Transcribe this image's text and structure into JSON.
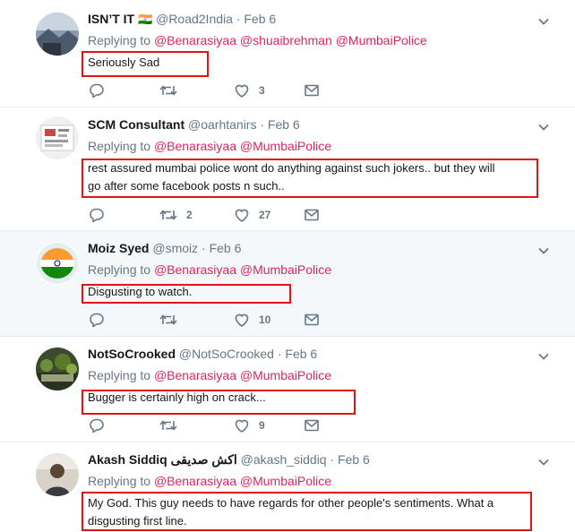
{
  "tweets": [
    {
      "name": "ISN’T IT",
      "flag": "🇮🇳",
      "handle": "@Road2India",
      "date": "Feb 6",
      "replying_to": "Replying to",
      "mentions": [
        "@Benarasiyaa",
        "@shuaibrehman",
        "@MumbaiPolice"
      ],
      "text": "Seriously Sad",
      "replies": "",
      "retweets": "",
      "likes": "3"
    },
    {
      "name": "SCM Consultant",
      "handle": "@oarhtanirs",
      "date": "Feb 6",
      "replying_to": "Replying to",
      "mentions": [
        "@Benarasiyaa",
        "@MumbaiPolice"
      ],
      "text_line1": "rest assured mumbai police wont do anything against such jokers.. but they will",
      "text_line2": "go after some facebook posts n such..",
      "replies": "",
      "retweets": "2",
      "likes": "27"
    },
    {
      "name": "Moiz Syed",
      "handle": "@smoiz",
      "date": "Feb 6",
      "replying_to": "Replying to",
      "mentions": [
        "@Benarasiyaa",
        "@MumbaiPolice"
      ],
      "text": "Disgusting to watch.",
      "replies": "",
      "retweets": "",
      "likes": "10"
    },
    {
      "name": "NotSoCrooked",
      "handle": "@NotSoCrooked",
      "date": "Feb 6",
      "replying_to": "Replying to",
      "mentions": [
        "@Benarasiyaa",
        "@MumbaiPolice"
      ],
      "text": "Bugger is certainly high on crack...",
      "replies": "",
      "retweets": "",
      "likes": "9"
    },
    {
      "name": "Akash Siddiq",
      "name_urdu": "اکش صدیقی",
      "handle": "@akash_siddiq",
      "date": "Feb 6",
      "replying_to": "Replying to",
      "mentions": [
        "@Benarasiyaa",
        "@MumbaiPolice"
      ],
      "text_line1": "My God. This guy needs to have regards for other people's sentiments. What a",
      "text_line2": "disgusting first line.",
      "replies": "",
      "retweets": "",
      "likes": ""
    }
  ],
  "colors": {
    "mention": "#e0245e",
    "muted": "#657786",
    "highlight_box": "#e21313",
    "hover_bg": "#f5f8fa"
  },
  "icons": [
    "reply-icon",
    "retweet-icon",
    "like-icon",
    "dm-icon",
    "chevron-down-icon"
  ]
}
